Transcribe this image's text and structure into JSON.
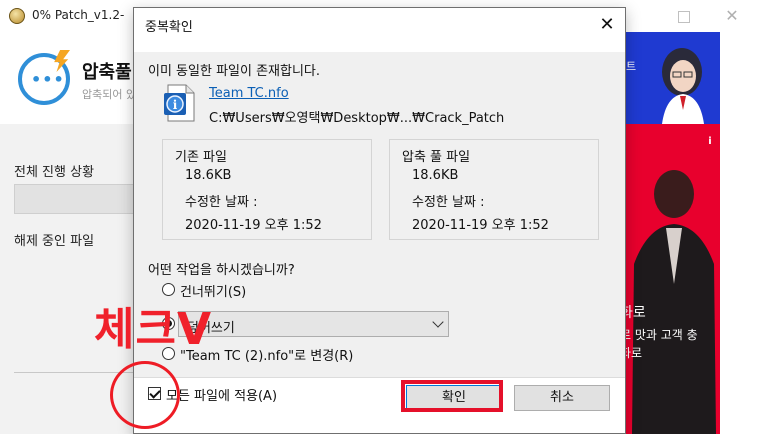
{
  "background_app": {
    "title": "0% Patch_v1.2-",
    "heading": "압축풀",
    "subheading": "압축되어 있",
    "progress_label": "전체 진행 상황",
    "extract_label": "해제 중인 파일",
    "ad": {
      "top_text": "트",
      "info_icon": "i",
      "line1": "화로",
      "line2": "로 맛과 고객 충",
      "line3": "화로"
    }
  },
  "dialog": {
    "title": "중복확인",
    "close_glyph": "✕",
    "message": "이미 동일한 파일이 존재합니다.",
    "file_name": "Team TC.nfo",
    "file_path": "C:₩Users₩오영택₩Desktop₩...₩Crack_Patch",
    "existing": {
      "title": "기존 파일",
      "size": "18.6KB",
      "modified_label": "수정한 날짜 :",
      "modified": "2020-11-19 오후 1:52"
    },
    "archive": {
      "title": "압축 풀 파일",
      "size": "18.6KB",
      "modified_label": "수정한 날짜 :",
      "modified": "2020-11-19 오후 1:52"
    },
    "question": "어떤 작업을 하시겠습니까?",
    "options": {
      "skip": "건너뛰기(S)",
      "overwrite_select": "덮어쓰기",
      "rename": "\"Team TC (2).nfo\"로 변경(R)"
    },
    "selected_option": "overwrite",
    "apply_all_label": "모든 파일에 적용(A)",
    "apply_all_checked": true,
    "ok_label": "확인",
    "cancel_label": "취소"
  },
  "annotation": {
    "text": "체크V",
    "color": "#f0212b"
  }
}
